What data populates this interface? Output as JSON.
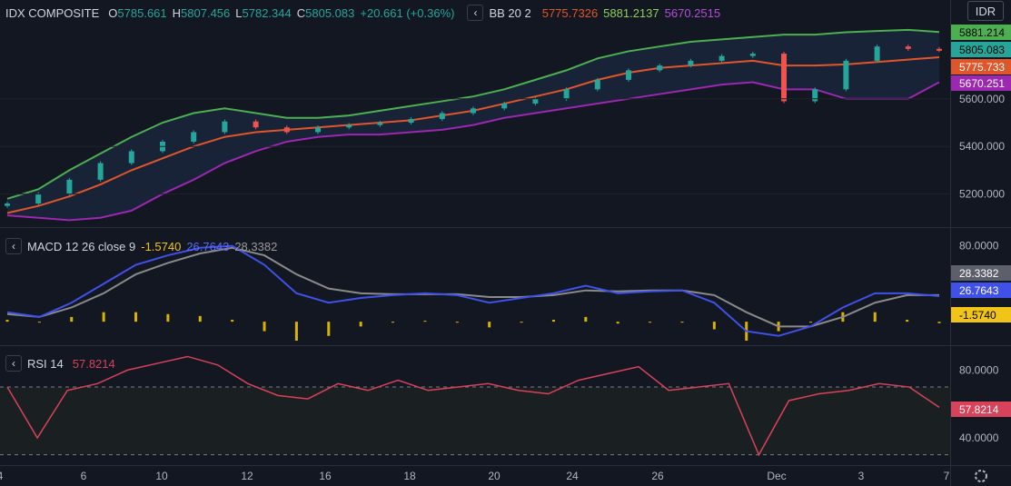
{
  "header": {
    "symbol": "IDX COMPOSITE",
    "o_label": "O",
    "o": "5785.661",
    "h_label": "H",
    "h": "5807.456",
    "l_label": "L",
    "l": "5782.344",
    "c_label": "C",
    "c": "5805.083",
    "change": "+20.661 (+0.36%)",
    "bb_name": "BB 20 2",
    "bb_basis": "5775.7326",
    "bb_upper": "5881.2137",
    "bb_lower": "5670.2515",
    "currency": "IDR"
  },
  "macd": {
    "name": "MACD 12 26 close 9",
    "hist": "-1.5740",
    "macd": "26.7643",
    "signal": "28.3382"
  },
  "rsi": {
    "name": "RSI 14",
    "value": "57.8214"
  },
  "price_axis": {
    "ticks": [
      "5600.000",
      "5400.000",
      "5200.000"
    ],
    "labels": {
      "upper": "5881.214",
      "close": "5805.083",
      "basis": "5775.733",
      "lower": "5670.251"
    }
  },
  "macd_axis": {
    "ticks": [
      "80.0000"
    ],
    "labels": {
      "signal": "28.3382",
      "macd": "26.7643",
      "hist": "-1.5740"
    }
  },
  "rsi_axis": {
    "ticks": [
      "80.0000",
      "40.0000"
    ],
    "labels": {
      "value": "57.8214"
    }
  },
  "x_axis": {
    "ticks": [
      "4",
      "6",
      "10",
      "12",
      "16",
      "18",
      "20",
      "24",
      "26",
      "Dec",
      "3",
      "7"
    ]
  },
  "colors": {
    "background": "#131722",
    "up": "#26a69a",
    "down": "#ef5350",
    "bb_upper": "#4caf50",
    "bb_basis": "#e0562b",
    "bb_lower": "#9c27b0",
    "macd": "#3f51e8",
    "signal": "#8a8a8a",
    "hist": "#d9b300",
    "rsi": "#d8425a"
  },
  "chart_data": [
    {
      "type": "line",
      "title": "IDX COMPOSITE",
      "candlestick": true,
      "x": [
        "Nov 4",
        "Nov 5",
        "Nov 6",
        "Nov 7",
        "Nov 8",
        "Nov 9",
        "Nov 10",
        "Nov 11",
        "Nov 12",
        "Nov 13",
        "Nov 14",
        "Nov 15",
        "Nov 16",
        "Nov 17",
        "Nov 18",
        "Nov 19",
        "Nov 20",
        "Nov 21",
        "Nov 22",
        "Nov 23",
        "Nov 24",
        "Nov 25",
        "Nov 26",
        "Nov 27",
        "Nov 28",
        "Nov 29",
        "Nov 30",
        "Dec 1",
        "Dec 2",
        "Dec 3",
        "Dec 4"
      ],
      "series": [
        {
          "name": "close",
          "values": [
            5160,
            5200,
            5260,
            5330,
            5380,
            5420,
            5460,
            5505,
            5480,
            5460,
            5480,
            5490,
            5500,
            5515,
            5540,
            5560,
            5580,
            5600,
            5640,
            5680,
            5720,
            5740,
            5760,
            5780,
            5790,
            5590,
            5640,
            5760,
            5820,
            5810,
            5805
          ]
        },
        {
          "name": "BB 20 2 upper",
          "values": [
            5180,
            5220,
            5300,
            5370,
            5440,
            5500,
            5540,
            5560,
            5540,
            5520,
            5520,
            5530,
            5550,
            5570,
            5590,
            5610,
            5640,
            5680,
            5720,
            5770,
            5800,
            5820,
            5840,
            5850,
            5860,
            5870,
            5870,
            5880,
            5885,
            5890,
            5881
          ]
        },
        {
          "name": "BB 20 2 basis",
          "values": [
            5120,
            5150,
            5190,
            5240,
            5300,
            5350,
            5400,
            5440,
            5460,
            5470,
            5480,
            5490,
            5500,
            5510,
            5530,
            5550,
            5580,
            5610,
            5640,
            5680,
            5710,
            5730,
            5740,
            5750,
            5760,
            5740,
            5740,
            5745,
            5755,
            5765,
            5775
          ]
        },
        {
          "name": "BB 20 2 lower",
          "values": [
            5110,
            5100,
            5090,
            5100,
            5130,
            5200,
            5260,
            5330,
            5380,
            5420,
            5440,
            5450,
            5450,
            5460,
            5470,
            5490,
            5520,
            5540,
            5560,
            5580,
            5600,
            5620,
            5640,
            5660,
            5670,
            5640,
            5640,
            5600,
            5600,
            5600,
            5670
          ]
        }
      ],
      "ylim": [
        5080,
        5920
      ]
    },
    {
      "type": "line",
      "title": "MACD 12 26 close 9",
      "series": [
        {
          "name": "MACD",
          "values": [
            10,
            5,
            20,
            40,
            60,
            70,
            78,
            80,
            60,
            30,
            20,
            25,
            28,
            30,
            28,
            20,
            25,
            30,
            38,
            30,
            32,
            33,
            20,
            -10,
            -15,
            -5,
            15,
            30,
            30,
            27
          ]
        },
        {
          "name": "Signal",
          "values": [
            8,
            5,
            15,
            30,
            50,
            62,
            72,
            78,
            70,
            50,
            35,
            30,
            29,
            29,
            29,
            26,
            26,
            28,
            33,
            32,
            33,
            33,
            28,
            10,
            -5,
            -5,
            5,
            20,
            28,
            28
          ]
        },
        {
          "name": "Histogram",
          "values": [
            2,
            0,
            5,
            10,
            10,
            8,
            6,
            2,
            -10,
            -20,
            -15,
            -5,
            -1,
            1,
            -1,
            -6,
            -1,
            2,
            5,
            -2,
            -1,
            0,
            -8,
            -20,
            -10,
            0,
            10,
            10,
            2,
            -1.57
          ]
        }
      ],
      "ylim": [
        -20,
        95
      ]
    },
    {
      "type": "line",
      "title": "RSI 14",
      "series": [
        {
          "name": "RSI",
          "values": [
            70,
            40,
            68,
            72,
            80,
            84,
            88,
            83,
            72,
            65,
            63,
            72,
            68,
            74,
            68,
            70,
            72,
            68,
            66,
            74,
            78,
            82,
            68,
            70,
            72,
            30,
            62,
            66,
            68,
            72,
            70,
            58
          ]
        }
      ],
      "bands": [
        70,
        30
      ],
      "ylim": [
        25,
        92
      ]
    }
  ]
}
